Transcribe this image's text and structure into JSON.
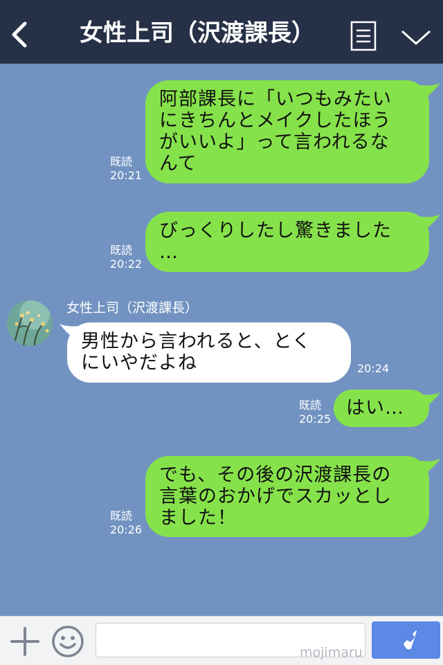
{
  "header": {
    "title": "女性上司（沢渡課長）",
    "back_icon": "chevron-left-icon",
    "menu_icon": "note-icon",
    "expand_icon": "chevron-down-icon",
    "background": "#263147"
  },
  "chat": {
    "background": "#7293c1",
    "sent_bubble_color": "#86e24a",
    "received_bubble_color": "#ffffff",
    "messages": [
      {
        "side": "sent",
        "text": "阿部課長に「いつもみたい\nにきちんとメイクしたほう\nがいいよ」って言われるな\nんて",
        "read": "既読",
        "time": "20:21"
      },
      {
        "side": "sent",
        "text": "びっくりしたし驚きました\n…",
        "read": "既読",
        "time": "20:22"
      },
      {
        "side": "received",
        "sender": "女性上司（沢渡課長）",
        "text": "男性から言われると、とく\nにいやだよね",
        "time": "20:24"
      },
      {
        "side": "sent",
        "text": "はい…",
        "read": "既読",
        "time": "20:25"
      },
      {
        "side": "sent",
        "text": "でも、その後の沢渡課長の\n言葉のおかげでスカッとし\nました！",
        "read": "既読",
        "time": "20:26"
      }
    ]
  },
  "input_bar": {
    "plus_icon": "plus-icon",
    "emoji_icon": "smiley-icon",
    "input_value": "",
    "watermark": "mojimaru",
    "call_icon": "phone-icon",
    "call_button_color": "#5c88e6"
  }
}
